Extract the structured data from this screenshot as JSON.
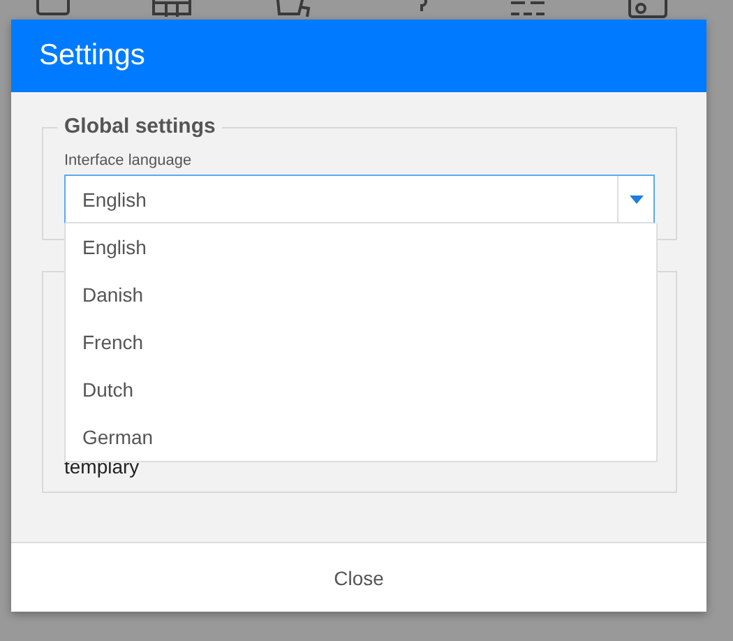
{
  "dialog": {
    "title": "Settings",
    "fieldsets": [
      {
        "legend": "Global settings",
        "label": "Interface language",
        "value": "English"
      },
      {
        "text": "templary"
      }
    ],
    "dropdown": {
      "open": true,
      "options": [
        {
          "label": "English",
          "selected": false
        },
        {
          "label": "Danish",
          "selected": false
        },
        {
          "label": "French",
          "selected": false
        },
        {
          "label": "Dutch",
          "selected": false
        },
        {
          "label": "German",
          "selected": false
        }
      ]
    },
    "buttons": [
      "Close"
    ]
  }
}
